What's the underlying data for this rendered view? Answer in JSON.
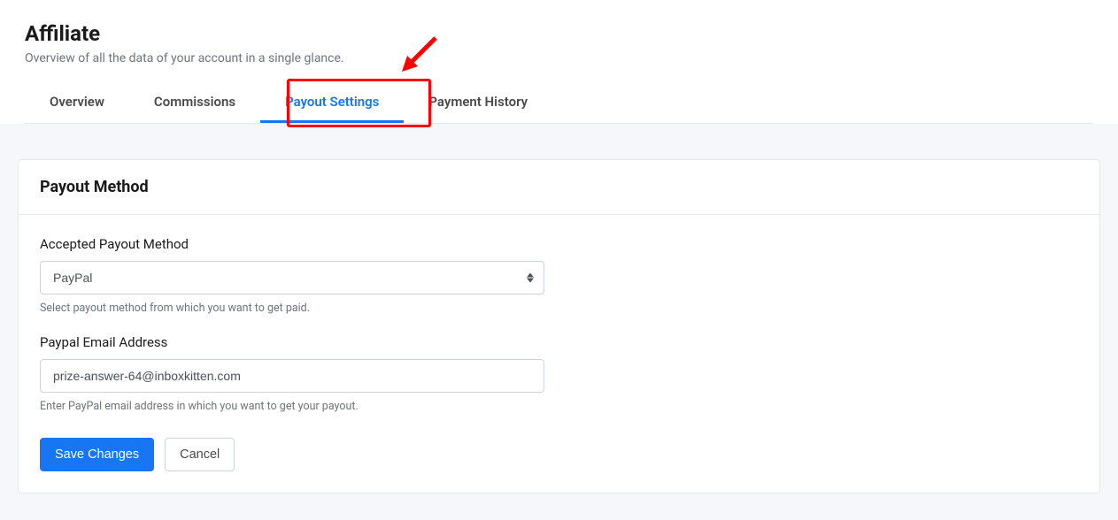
{
  "header": {
    "title": "Affiliate",
    "subtitle": "Overview of all the data of your account in a single glance."
  },
  "tabs": [
    {
      "label": "Overview",
      "active": false
    },
    {
      "label": "Commissions",
      "active": false
    },
    {
      "label": "Payout Settings",
      "active": true
    },
    {
      "label": "Payment History",
      "active": false
    }
  ],
  "card": {
    "title": "Payout Method",
    "payout_method": {
      "label": "Accepted Payout Method",
      "value": "PayPal",
      "help": "Select payout method from which you want to get paid."
    },
    "paypal_email": {
      "label": "Paypal Email Address",
      "value": "prize-answer-64@inboxkitten.com",
      "help": "Enter PayPal email address in which you want to get your payout."
    },
    "buttons": {
      "save": "Save Changes",
      "cancel": "Cancel"
    }
  },
  "annotation": {
    "arrow_color": "#ff0000",
    "highlight_color": "#ff0000"
  }
}
